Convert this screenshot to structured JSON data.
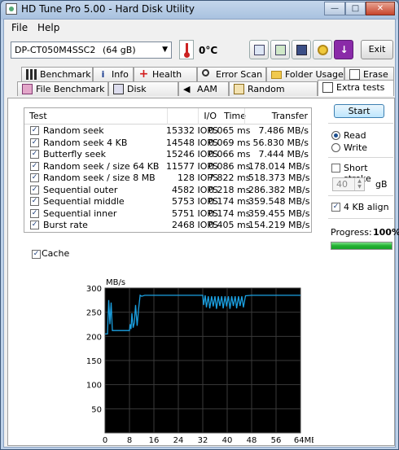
{
  "window": {
    "title": "HD Tune Pro 5.00 - Hard Disk Utility"
  },
  "menu": {
    "file": "File",
    "help": "Help"
  },
  "toolbar": {
    "drive_name": "DP-CT050M4SSC2",
    "drive_size": "(64 gB)",
    "temperature": "0°C",
    "exit_label": "Exit"
  },
  "tabs": {
    "row1": [
      "Benchmark",
      "Info",
      "Health",
      "Error Scan",
      "Folder Usage",
      "Erase"
    ],
    "row2": [
      "File Benchmark",
      "Disk monitor",
      "AAM",
      "Random Access",
      "Extra tests"
    ],
    "active": "Extra tests"
  },
  "table": {
    "headers": [
      "Test",
      "I/O",
      "Time",
      "Transfer"
    ],
    "rows": [
      {
        "test": "Random seek",
        "io": "15332 IOPS",
        "time": "0.065 ms",
        "transfer": "7.486 MB/s"
      },
      {
        "test": "Random seek 4 KB",
        "io": "14548 IOPS",
        "time": "0.069 ms",
        "transfer": "56.830 MB/s"
      },
      {
        "test": "Butterfly seek",
        "io": "15246 IOPS",
        "time": "0.066 ms",
        "transfer": "7.444 MB/s"
      },
      {
        "test": "Random seek / size 64 KB",
        "io": "11577 IOPS",
        "time": "0.086 ms",
        "transfer": "178.014 MB/s"
      },
      {
        "test": "Random seek / size 8 MB",
        "io": "128 IOPS",
        "time": "7.822 ms",
        "transfer": "518.373 MB/s"
      },
      {
        "test": "Sequential outer",
        "io": "4582 IOPS",
        "time": "0.218 ms",
        "transfer": "286.382 MB/s"
      },
      {
        "test": "Sequential middle",
        "io": "5753 IOPS",
        "time": "0.174 ms",
        "transfer": "359.548 MB/s"
      },
      {
        "test": "Sequential inner",
        "io": "5751 IOPS",
        "time": "0.174 ms",
        "transfer": "359.455 MB/s"
      },
      {
        "test": "Burst rate",
        "io": "2468 IOPS",
        "time": "0.405 ms",
        "transfer": "154.219 MB/s"
      }
    ]
  },
  "cache_label": "Cache",
  "side": {
    "start": "Start",
    "read": "Read",
    "write": "Write",
    "short_stroke": "Short stroke",
    "stroke_value": "40",
    "stroke_unit": "gB",
    "align": "4 KB align",
    "progress_label": "Progress:",
    "progress_value": "100%",
    "progress_fraction": 1.0
  },
  "chart_data": {
    "type": "line",
    "ylabel": "MB/s",
    "xunit": "MB",
    "ylim": [
      0,
      300
    ],
    "xlim": [
      0,
      64
    ],
    "yticks": [
      50,
      100,
      150,
      200,
      250,
      300
    ],
    "xticks": [
      0,
      8,
      16,
      24,
      32,
      40,
      48,
      56,
      64
    ],
    "xtick_labels": [
      "0",
      "8",
      "16",
      "24",
      "32",
      "40",
      "48",
      "56",
      "64MB"
    ],
    "grid": true,
    "color": "#1ba1e2",
    "x": [
      0,
      0.8,
      1.2,
      1.6,
      2.0,
      2.4,
      2.8,
      3.2,
      3.6,
      4.0,
      4.5,
      5.0,
      5.5,
      6.0,
      6.5,
      7.0,
      7.5,
      8.0,
      8.2,
      8.5,
      8.8,
      9.2,
      9.6,
      10.0,
      10.5,
      11.0,
      11.5,
      12.0,
      13.0,
      14.0,
      16,
      20,
      24,
      28,
      31.5,
      32.0,
      32.3,
      32.8,
      33.2,
      33.8,
      34.3,
      34.9,
      35.4,
      36.0,
      36.5,
      37.1,
      37.6,
      38.2,
      38.7,
      39.3,
      39.8,
      40.4,
      40.9,
      41.5,
      42.0,
      42.6,
      43.1,
      43.7,
      44.2,
      44.8,
      45.3,
      46,
      48,
      52,
      56,
      60,
      64
    ],
    "y": [
      205,
      205,
      275,
      225,
      270,
      212,
      212,
      212,
      212,
      212,
      212,
      212,
      212,
      212,
      212,
      212,
      212,
      212,
      225,
      215,
      248,
      218,
      228,
      265,
      222,
      258,
      285,
      283,
      285,
      285,
      285,
      285,
      285,
      285,
      285,
      285,
      265,
      285,
      260,
      283,
      258,
      283,
      262,
      283,
      257,
      283,
      263,
      283,
      258,
      283,
      262,
      283,
      257,
      283,
      263,
      283,
      258,
      283,
      263,
      283,
      260,
      284,
      285,
      285,
      285,
      285,
      285
    ]
  }
}
